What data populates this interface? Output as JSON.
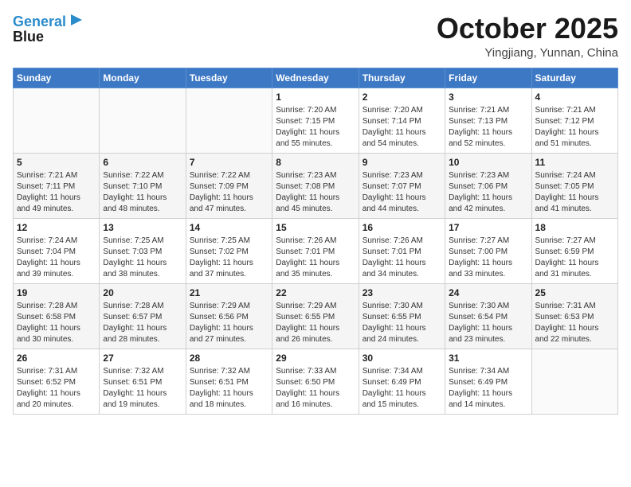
{
  "logo": {
    "line1": "General",
    "line2": "Blue"
  },
  "title": "October 2025",
  "location": "Yingjiang, Yunnan, China",
  "weekdays": [
    "Sunday",
    "Monday",
    "Tuesday",
    "Wednesday",
    "Thursday",
    "Friday",
    "Saturday"
  ],
  "weeks": [
    [
      {
        "day": "",
        "info": ""
      },
      {
        "day": "",
        "info": ""
      },
      {
        "day": "",
        "info": ""
      },
      {
        "day": "1",
        "info": "Sunrise: 7:20 AM\nSunset: 7:15 PM\nDaylight: 11 hours\nand 55 minutes."
      },
      {
        "day": "2",
        "info": "Sunrise: 7:20 AM\nSunset: 7:14 PM\nDaylight: 11 hours\nand 54 minutes."
      },
      {
        "day": "3",
        "info": "Sunrise: 7:21 AM\nSunset: 7:13 PM\nDaylight: 11 hours\nand 52 minutes."
      },
      {
        "day": "4",
        "info": "Sunrise: 7:21 AM\nSunset: 7:12 PM\nDaylight: 11 hours\nand 51 minutes."
      }
    ],
    [
      {
        "day": "5",
        "info": "Sunrise: 7:21 AM\nSunset: 7:11 PM\nDaylight: 11 hours\nand 49 minutes."
      },
      {
        "day": "6",
        "info": "Sunrise: 7:22 AM\nSunset: 7:10 PM\nDaylight: 11 hours\nand 48 minutes."
      },
      {
        "day": "7",
        "info": "Sunrise: 7:22 AM\nSunset: 7:09 PM\nDaylight: 11 hours\nand 47 minutes."
      },
      {
        "day": "8",
        "info": "Sunrise: 7:23 AM\nSunset: 7:08 PM\nDaylight: 11 hours\nand 45 minutes."
      },
      {
        "day": "9",
        "info": "Sunrise: 7:23 AM\nSunset: 7:07 PM\nDaylight: 11 hours\nand 44 minutes."
      },
      {
        "day": "10",
        "info": "Sunrise: 7:23 AM\nSunset: 7:06 PM\nDaylight: 11 hours\nand 42 minutes."
      },
      {
        "day": "11",
        "info": "Sunrise: 7:24 AM\nSunset: 7:05 PM\nDaylight: 11 hours\nand 41 minutes."
      }
    ],
    [
      {
        "day": "12",
        "info": "Sunrise: 7:24 AM\nSunset: 7:04 PM\nDaylight: 11 hours\nand 39 minutes."
      },
      {
        "day": "13",
        "info": "Sunrise: 7:25 AM\nSunset: 7:03 PM\nDaylight: 11 hours\nand 38 minutes."
      },
      {
        "day": "14",
        "info": "Sunrise: 7:25 AM\nSunset: 7:02 PM\nDaylight: 11 hours\nand 37 minutes."
      },
      {
        "day": "15",
        "info": "Sunrise: 7:26 AM\nSunset: 7:01 PM\nDaylight: 11 hours\nand 35 minutes."
      },
      {
        "day": "16",
        "info": "Sunrise: 7:26 AM\nSunset: 7:01 PM\nDaylight: 11 hours\nand 34 minutes."
      },
      {
        "day": "17",
        "info": "Sunrise: 7:27 AM\nSunset: 7:00 PM\nDaylight: 11 hours\nand 33 minutes."
      },
      {
        "day": "18",
        "info": "Sunrise: 7:27 AM\nSunset: 6:59 PM\nDaylight: 11 hours\nand 31 minutes."
      }
    ],
    [
      {
        "day": "19",
        "info": "Sunrise: 7:28 AM\nSunset: 6:58 PM\nDaylight: 11 hours\nand 30 minutes."
      },
      {
        "day": "20",
        "info": "Sunrise: 7:28 AM\nSunset: 6:57 PM\nDaylight: 11 hours\nand 28 minutes."
      },
      {
        "day": "21",
        "info": "Sunrise: 7:29 AM\nSunset: 6:56 PM\nDaylight: 11 hours\nand 27 minutes."
      },
      {
        "day": "22",
        "info": "Sunrise: 7:29 AM\nSunset: 6:55 PM\nDaylight: 11 hours\nand 26 minutes."
      },
      {
        "day": "23",
        "info": "Sunrise: 7:30 AM\nSunset: 6:55 PM\nDaylight: 11 hours\nand 24 minutes."
      },
      {
        "day": "24",
        "info": "Sunrise: 7:30 AM\nSunset: 6:54 PM\nDaylight: 11 hours\nand 23 minutes."
      },
      {
        "day": "25",
        "info": "Sunrise: 7:31 AM\nSunset: 6:53 PM\nDaylight: 11 hours\nand 22 minutes."
      }
    ],
    [
      {
        "day": "26",
        "info": "Sunrise: 7:31 AM\nSunset: 6:52 PM\nDaylight: 11 hours\nand 20 minutes."
      },
      {
        "day": "27",
        "info": "Sunrise: 7:32 AM\nSunset: 6:51 PM\nDaylight: 11 hours\nand 19 minutes."
      },
      {
        "day": "28",
        "info": "Sunrise: 7:32 AM\nSunset: 6:51 PM\nDaylight: 11 hours\nand 18 minutes."
      },
      {
        "day": "29",
        "info": "Sunrise: 7:33 AM\nSunset: 6:50 PM\nDaylight: 11 hours\nand 16 minutes."
      },
      {
        "day": "30",
        "info": "Sunrise: 7:34 AM\nSunset: 6:49 PM\nDaylight: 11 hours\nand 15 minutes."
      },
      {
        "day": "31",
        "info": "Sunrise: 7:34 AM\nSunset: 6:49 PM\nDaylight: 11 hours\nand 14 minutes."
      },
      {
        "day": "",
        "info": ""
      }
    ]
  ]
}
